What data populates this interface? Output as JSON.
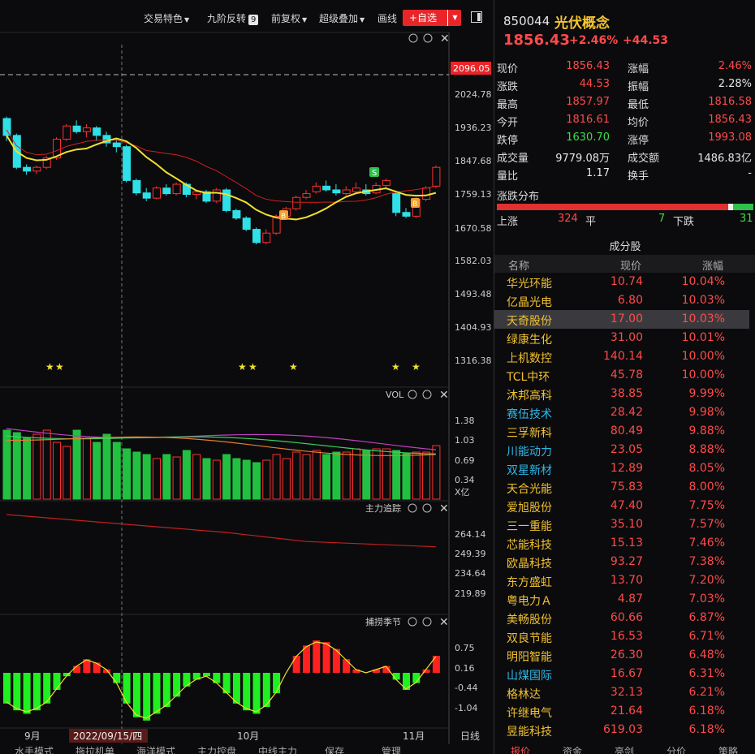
{
  "toolbar": {
    "items": [
      "交易特色",
      "九阶反转",
      "前复权",
      "超级叠加",
      "画线"
    ],
    "nine_badge": "9",
    "add_watch": "+自选"
  },
  "chart": {
    "dates": [
      "9月",
      "2022/09/15/四",
      "10月",
      "11月"
    ],
    "period_button": "日线",
    "price_axis": [
      "2024.78",
      "1936.23",
      "1847.68",
      "1759.13",
      "1670.58",
      "1582.03",
      "1493.48",
      "1404.93",
      "1316.38"
    ],
    "price_marker": "2096.05",
    "vol_label": "VOL",
    "vol_axis": [
      "1.38",
      "1.03",
      "0.69",
      "0.34"
    ],
    "vol_unit": "X亿",
    "main_label": "主力追踪",
    "main_axis": [
      "264.14",
      "249.39",
      "234.64",
      "219.89"
    ],
    "season_label": "捕捞季节",
    "season_axis": [
      "0.75",
      "0.16",
      "-0.44",
      "-1.04"
    ],
    "sell_marker": "S",
    "buy_marker": "B",
    "bottom_tabs": [
      "水手模式",
      "拖拉机单",
      "海洋模式",
      "主力控盘",
      "中线主力",
      "保存",
      "管理"
    ]
  },
  "chart_data": {
    "type": "candlestick",
    "x": [
      "d1",
      "d2",
      "d3",
      "d4",
      "d5",
      "d6",
      "d7",
      "d8",
      "d9",
      "d10",
      "d11",
      "d12",
      "d13",
      "d14",
      "d15",
      "d16",
      "d17",
      "d18",
      "d19",
      "d20",
      "d21",
      "d22",
      "d23",
      "d24",
      "d25",
      "d26",
      "d27",
      "d28",
      "d29",
      "d30",
      "d31",
      "d32",
      "d33",
      "d34",
      "d35",
      "d36",
      "d37",
      "d38",
      "d39",
      "d40",
      "d41",
      "d42",
      "d43",
      "d44"
    ],
    "candles": [
      [
        1960,
        1965,
        1900,
        1915
      ],
      [
        1915,
        1920,
        1825,
        1830
      ],
      [
        1830,
        1838,
        1810,
        1820
      ],
      [
        1820,
        1835,
        1812,
        1830
      ],
      [
        1830,
        1860,
        1825,
        1855
      ],
      [
        1855,
        1910,
        1850,
        1905
      ],
      [
        1905,
        1945,
        1900,
        1940
      ],
      [
        1940,
        1955,
        1920,
        1925
      ],
      [
        1925,
        1945,
        1910,
        1935
      ],
      [
        1935,
        1940,
        1900,
        1915
      ],
      [
        1915,
        1925,
        1885,
        1895
      ],
      [
        1895,
        1905,
        1870,
        1885
      ],
      [
        1885,
        1890,
        1790,
        1795
      ],
      [
        1795,
        1800,
        1755,
        1762
      ],
      [
        1762,
        1775,
        1740,
        1748
      ],
      [
        1748,
        1780,
        1745,
        1775
      ],
      [
        1775,
        1785,
        1755,
        1760
      ],
      [
        1760,
        1790,
        1755,
        1785
      ],
      [
        1785,
        1790,
        1750,
        1758
      ],
      [
        1758,
        1770,
        1745,
        1765
      ],
      [
        1765,
        1770,
        1735,
        1740
      ],
      [
        1740,
        1775,
        1735,
        1770
      ],
      [
        1770,
        1775,
        1710,
        1715
      ],
      [
        1715,
        1720,
        1690,
        1695
      ],
      [
        1695,
        1700,
        1660,
        1665
      ],
      [
        1665,
        1670,
        1625,
        1630
      ],
      [
        1630,
        1665,
        1625,
        1655
      ],
      [
        1655,
        1705,
        1650,
        1700
      ],
      [
        1700,
        1725,
        1695,
        1720
      ],
      [
        1720,
        1755,
        1715,
        1750
      ],
      [
        1750,
        1770,
        1745,
        1760
      ],
      [
        1765,
        1790,
        1760,
        1780
      ],
      [
        1780,
        1795,
        1765,
        1770
      ],
      [
        1770,
        1785,
        1755,
        1762
      ],
      [
        1760,
        1780,
        1755,
        1770
      ],
      [
        1765,
        1790,
        1760,
        1775
      ],
      [
        1770,
        1785,
        1755,
        1760
      ],
      [
        1762,
        1790,
        1758,
        1782
      ],
      [
        1782,
        1800,
        1775,
        1795
      ],
      [
        1760,
        1765,
        1700,
        1710
      ],
      [
        1710,
        1722,
        1695,
        1700
      ],
      [
        1700,
        1750,
        1695,
        1745
      ],
      [
        1745,
        1780,
        1740,
        1775
      ],
      [
        1780,
        1835,
        1775,
        1830
      ]
    ],
    "ylim": [
      1316.38,
      2096.05
    ]
  },
  "quote": {
    "code": "850044",
    "name": "光伏概念",
    "price": "1856.43",
    "pct": "+2.46%",
    "amt": "+44.53",
    "rows": [
      {
        "l1": "现价",
        "v1": "1856.43",
        "c1": "red",
        "l2": "涨幅",
        "v2": "2.46%",
        "c2": "red"
      },
      {
        "l1": "涨跌",
        "v1": "44.53",
        "c1": "red",
        "l2": "振幅",
        "v2": "2.28%",
        "c2": "white"
      },
      {
        "l1": "最高",
        "v1": "1857.97",
        "c1": "red",
        "l2": "最低",
        "v2": "1816.58",
        "c2": "red"
      },
      {
        "l1": "今开",
        "v1": "1816.61",
        "c1": "red",
        "l2": "均价",
        "v2": "1856.43",
        "c2": "red"
      },
      {
        "l1": "跌停",
        "v1": "1630.70",
        "c1": "green",
        "l2": "涨停",
        "v2": "1993.08",
        "c2": "red"
      },
      {
        "l1": "成交量",
        "v1": "9779.08万",
        "c1": "white",
        "l2": "成交额",
        "v2": "1486.83亿",
        "c2": "white"
      },
      {
        "l1": "量比",
        "v1": "1.17",
        "c1": "white",
        "l2": "换手",
        "v2": "-",
        "c2": "white"
      }
    ],
    "dist_title": "涨跌分布",
    "up_label": "上涨",
    "up_count": "324",
    "flat_label": "平",
    "flat_count": "7",
    "down_label": "下跌",
    "down_count": "31",
    "cons_title": "成分股",
    "head": [
      "名称",
      "现价",
      "涨幅"
    ],
    "stocks": [
      {
        "name": "华光环能",
        "price": "10.74",
        "pct": "10.04%",
        "color": "yellow"
      },
      {
        "name": "亿晶光电",
        "price": "6.80",
        "pct": "10.03%",
        "color": "yellow"
      },
      {
        "name": "天奇股份",
        "price": "17.00",
        "pct": "10.03%",
        "color": "yellow"
      },
      {
        "name": "绿康生化",
        "price": "31.00",
        "pct": "10.01%",
        "color": "yellow"
      },
      {
        "name": "上机数控",
        "price": "140.14",
        "pct": "10.00%",
        "color": "yellow"
      },
      {
        "name": "TCL中环",
        "price": "45.78",
        "pct": "10.00%",
        "color": "yellow"
      },
      {
        "name": "沐邦高科",
        "price": "38.85",
        "pct": "9.99%",
        "color": "yellow"
      },
      {
        "name": "赛伍技术",
        "price": "28.42",
        "pct": "9.98%",
        "color": "cyan"
      },
      {
        "name": "三孚新科",
        "price": "80.49",
        "pct": "9.88%",
        "color": "yellow"
      },
      {
        "name": "川能动力",
        "price": "23.05",
        "pct": "8.88%",
        "color": "cyan"
      },
      {
        "name": "双星新材",
        "price": "12.89",
        "pct": "8.05%",
        "color": "cyan"
      },
      {
        "name": "天合光能",
        "price": "75.83",
        "pct": "8.00%",
        "color": "yellow"
      },
      {
        "name": "爱旭股份",
        "price": "47.40",
        "pct": "7.75%",
        "color": "yellow"
      },
      {
        "name": "三一重能",
        "price": "35.10",
        "pct": "7.57%",
        "color": "yellow"
      },
      {
        "name": "芯能科技",
        "price": "15.13",
        "pct": "7.46%",
        "color": "yellow"
      },
      {
        "name": "欧晶科技",
        "price": "93.27",
        "pct": "7.38%",
        "color": "yellow"
      },
      {
        "name": "东方盛虹",
        "price": "13.70",
        "pct": "7.20%",
        "color": "yellow"
      },
      {
        "name": "粤电力Ａ",
        "price": "4.87",
        "pct": "7.03%",
        "color": "yellow"
      },
      {
        "name": "美畅股份",
        "price": "60.66",
        "pct": "6.87%",
        "color": "yellow"
      },
      {
        "name": "双良节能",
        "price": "16.53",
        "pct": "6.71%",
        "color": "yellow"
      },
      {
        "name": "明阳智能",
        "price": "26.30",
        "pct": "6.48%",
        "color": "yellow"
      },
      {
        "name": "山煤国际",
        "price": "16.67",
        "pct": "6.31%",
        "color": "cyan"
      },
      {
        "name": "格林达",
        "price": "32.13",
        "pct": "6.21%",
        "color": "yellow"
      },
      {
        "name": "许继电气",
        "price": "21.64",
        "pct": "6.18%",
        "color": "yellow"
      },
      {
        "name": "昱能科技",
        "price": "619.03",
        "pct": "6.18%",
        "color": "yellow"
      }
    ],
    "bottom_tabs": [
      "报价",
      "资金",
      "亮剑",
      "分价",
      "策略"
    ]
  }
}
